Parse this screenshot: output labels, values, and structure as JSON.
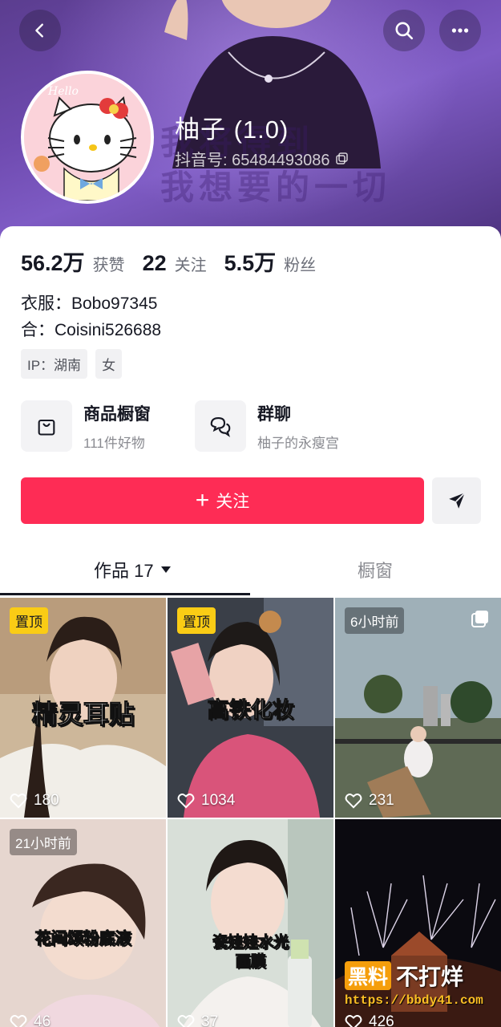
{
  "header": {
    "banner_text_line1": "我将得到",
    "banner_text_line2": "我想要的一切",
    "avatar_text": "Hello"
  },
  "profile": {
    "name": "柚子 (1.0)",
    "douyin_id": "抖音号: 65484493086"
  },
  "stats": [
    {
      "value": "56.2万",
      "label": "获赞"
    },
    {
      "value": "22",
      "label": "关注"
    },
    {
      "value": "5.5万",
      "label": "粉丝"
    }
  ],
  "bio": {
    "line1": "衣服：Bobo97345",
    "line2": "合：Coisini526688"
  },
  "tags": [
    "IP：湖南",
    "女"
  ],
  "entries": {
    "shop": {
      "title": "商品橱窗",
      "subtitle": "111件好物"
    },
    "group": {
      "title": "群聊",
      "subtitle": "柚子的永瘦宫"
    }
  },
  "actions": {
    "follow_label": "关注",
    "follow_plus": "+"
  },
  "tabs": {
    "works_label": "作品 17",
    "shop_label": "橱窗"
  },
  "videos": [
    {
      "badge": "置顶",
      "caption": "精灵耳贴",
      "likes": "180"
    },
    {
      "badge": "置顶",
      "caption": "高铁化妆",
      "likes": "1034"
    },
    {
      "badge": "6小时前",
      "caption": "",
      "likes": "231"
    },
    {
      "badge": "21小时前",
      "caption": "花间颂粉底液",
      "likes": "46"
    },
    {
      "badge": "",
      "caption": "瓷娃娃水光\n面膜",
      "likes": "37"
    },
    {
      "badge": "",
      "caption": "",
      "likes": "426"
    }
  ],
  "watermark": {
    "box": "黑料",
    "rest": "不打烊",
    "url": "https://bbdy41.com"
  },
  "colors": {
    "accent": "#fe2c55",
    "pin_badge": "#facc15",
    "banner": "#6f4bb0"
  }
}
